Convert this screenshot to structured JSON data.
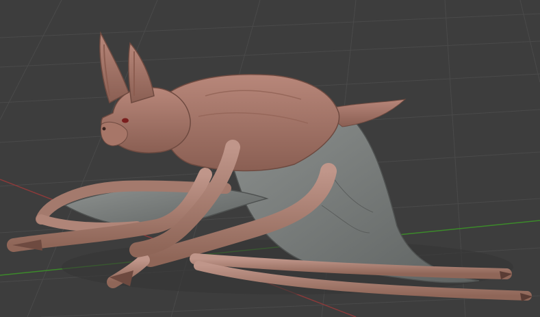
{
  "viewport": {
    "kind": "3d-viewport",
    "background": "#3d3d3d",
    "grid_color": "#4b4b4b",
    "x_axis_color": "#8c3a3a",
    "y_axis_color": "#3c8a2a"
  },
  "model": {
    "subject": "bat-creature",
    "skin_color": "#a9766a",
    "skin_shadow": "#7c5247",
    "membrane_color": "#6b6e6d",
    "membrane_highlight": "#8e9290",
    "eye_color": "#7a1e1e"
  }
}
